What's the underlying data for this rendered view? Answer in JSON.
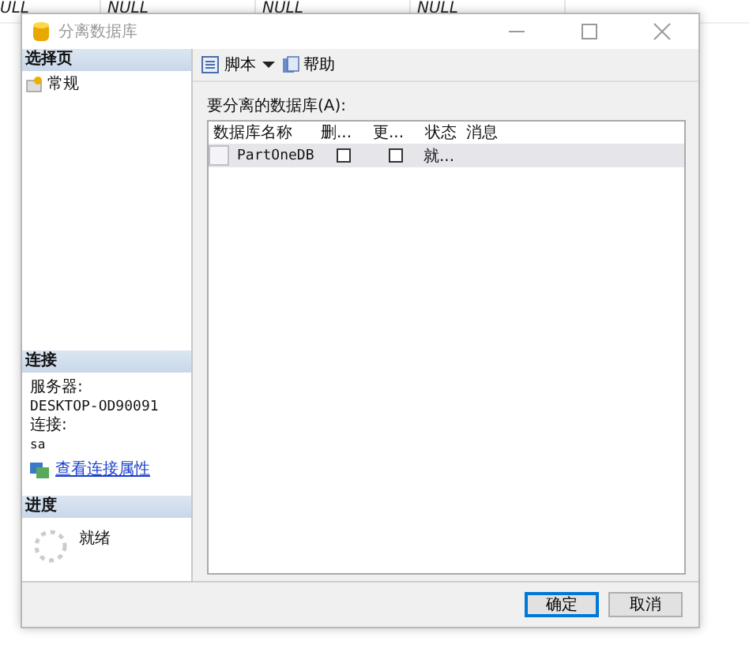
{
  "background_grid": {
    "cells": [
      "ULL",
      "NULL",
      "NULL",
      "NULL"
    ]
  },
  "window": {
    "title": "分离数据库"
  },
  "sidebar": {
    "header": "选择页",
    "items": [
      {
        "label": "常规"
      }
    ]
  },
  "connection": {
    "header": "连接",
    "server_label": "服务器:",
    "server": "DESKTOP-OD90091",
    "connection_label": "连接:",
    "user": "sa",
    "link": "查看连接属性"
  },
  "progress": {
    "header": "进度",
    "status": "就绪"
  },
  "toolbar": {
    "script": "脚本",
    "help": "帮助"
  },
  "databases_label": "要分离的数据库(A):",
  "table": {
    "columns": [
      "数据库名称",
      "删...",
      "更...",
      "状态",
      "消息"
    ],
    "rows": [
      {
        "name": "PartOneDB",
        "drop_connections": false,
        "update_statistics": false,
        "status": "就..."
      }
    ]
  },
  "buttons": [
    {
      "label": "确定",
      "default": true
    },
    {
      "label": "取消",
      "default": false
    }
  ]
}
